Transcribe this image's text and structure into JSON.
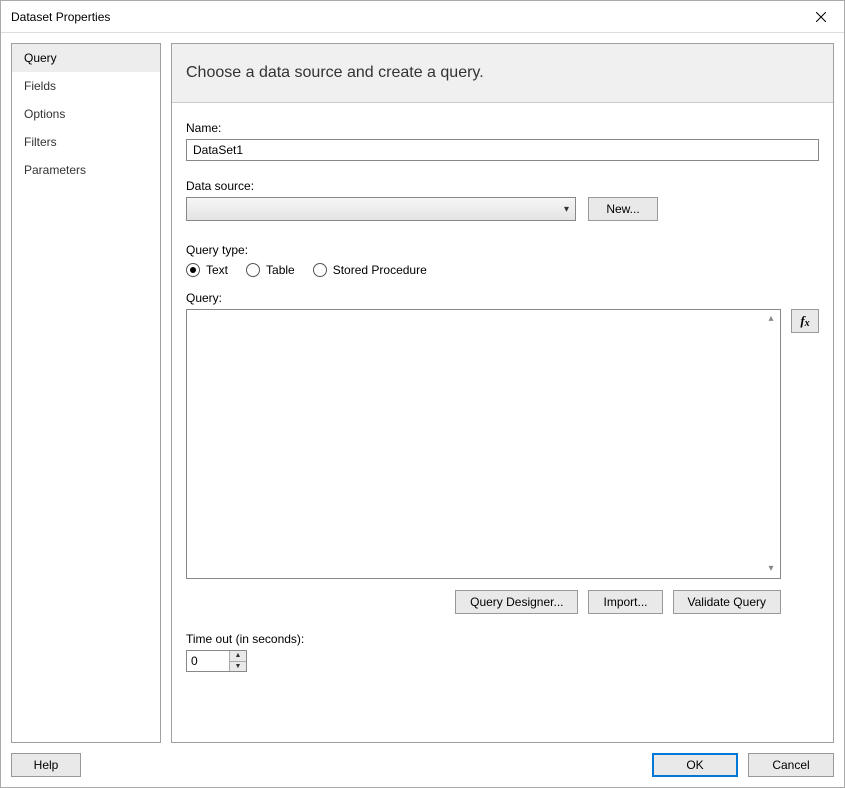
{
  "window": {
    "title": "Dataset Properties"
  },
  "sidebar": {
    "items": [
      {
        "label": "Query",
        "selected": true
      },
      {
        "label": "Fields",
        "selected": false
      },
      {
        "label": "Options",
        "selected": false
      },
      {
        "label": "Filters",
        "selected": false
      },
      {
        "label": "Parameters",
        "selected": false
      }
    ]
  },
  "main": {
    "heading": "Choose a data source and create a query.",
    "name_label": "Name:",
    "name_value": "DataSet1",
    "datasource_label": "Data source:",
    "datasource_value": "",
    "new_button": "New...",
    "querytype_label": "Query type:",
    "querytype_options": [
      {
        "label": "Text",
        "selected": true
      },
      {
        "label": "Table",
        "selected": false
      },
      {
        "label": "Stored Procedure",
        "selected": false
      }
    ],
    "query_label": "Query:",
    "query_value": "",
    "fx_label": "fx",
    "query_designer_button": "Query Designer...",
    "import_button": "Import...",
    "validate_button": "Validate Query",
    "timeout_label": "Time out (in seconds):",
    "timeout_value": "0"
  },
  "footer": {
    "help": "Help",
    "ok": "OK",
    "cancel": "Cancel"
  }
}
